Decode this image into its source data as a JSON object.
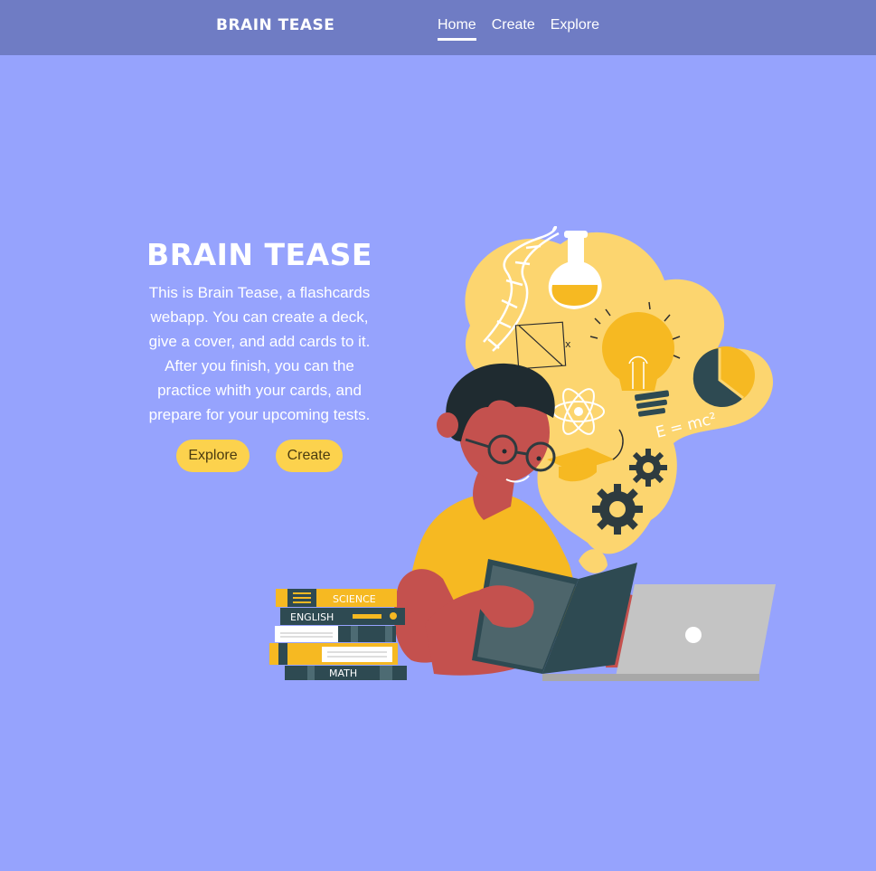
{
  "nav": {
    "logo": "BRAIN TEASE",
    "links": [
      "Home",
      "Create",
      "Explore"
    ]
  },
  "hero": {
    "title": "BRAIN TEASE",
    "description": "This is Brain Tease, a flashcards webapp. You can create a deck, give a cover, and add cards to it. After you finish, you can the practice whith your cards, and prepare for your upcoming tests.",
    "buttons": {
      "explore": "Explore",
      "create": "Create"
    }
  },
  "illustration": {
    "books": [
      "SCIENCE",
      "ENGLISH",
      "MATH"
    ],
    "formula": "E = mc²",
    "icons": [
      "dna-icon",
      "flask-icon",
      "lightbulb-icon",
      "pie-chart-icon",
      "atom-icon",
      "gear-icon",
      "graduation-cap-icon"
    ]
  },
  "colors": {
    "background": "#96a3fd",
    "navbar": "#6f7cc4",
    "accent": "#fcd24d",
    "dark": "#2e4a52",
    "skin": "#c4514e"
  }
}
